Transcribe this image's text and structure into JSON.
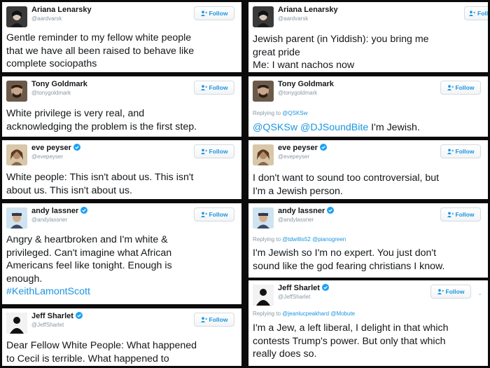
{
  "follow_label": "Follow",
  "follow_label_clipped": "Follo",
  "left": [
    {
      "name": "Ariana Lenarsky",
      "handle": "@aardvarsk",
      "text": "Gentle reminder to my fellow white people\nthat we have all been raised to behave like\ncomplete sociopaths"
    },
    {
      "name": "Tony Goldmark",
      "handle": "@tonygoldmark",
      "text": "White privilege is very real, and\nacknowledging the problem is the first step."
    },
    {
      "name": "eve peyser",
      "handle": "@evepeyser",
      "text": "White people: This isn't about us. This isn't\nabout us. This isn't about us."
    },
    {
      "name": "andy lassner",
      "handle": "@andylassner",
      "text": "Angry & heartbroken and I'm white &\nprivileged. Can't imagine what African\nAmericans feel like tonight. Enough is\nenough.",
      "hashtag": "#KeithLamontScott"
    },
    {
      "name": "Jeff Sharlet",
      "handle": "@JeffSharlet",
      "text": "Dear Fellow White People: What happened\nto Cecil is terrible. What happened to"
    }
  ],
  "right": [
    {
      "name": "Ariana Lenarsky",
      "handle": "@aardvarsk",
      "text": "Jewish parent (in Yiddish): you bring me\ngreat pride\nMe: I want nachos now"
    },
    {
      "name": "Tony Goldmark",
      "handle": "@tonygoldmark",
      "reply_prefix": "Replying to",
      "reply_to": "@QSKSw",
      "mentions": "@QSKSw @DJSoundBite",
      "text": " I'm Jewish."
    },
    {
      "name": "eve peyser",
      "handle": "@evepeyser",
      "text": "I don't want to sound too controversial, but\nI'm a Jewish person."
    },
    {
      "name": "andy lassner",
      "handle": "@andylassner",
      "reply_prefix": "Replying to",
      "reply_to": "@tdwillis52 @pianogreen",
      "text": "I'm Jewish so I'm no expert. You just don't\nsound like the god fearing christians I know."
    },
    {
      "name": "Jeff Sharlet",
      "handle": "@JeffSharlet",
      "reply_prefix": "Replying to",
      "reply_to": "@jeanlucpeakhard @Mobute",
      "text": "I'm a Jew, a left liberal, I delight in that which\ncontests Trump's power. But only that which\nreally does so."
    }
  ],
  "icons": {
    "follow": "add-person-icon",
    "verified": "verified-badge-icon",
    "more": "more-dot-icon"
  },
  "colors": {
    "link_blue": "#1b95e0",
    "text": "#14171a",
    "muted": "#8899a6",
    "frame": "#0b0b0b"
  }
}
